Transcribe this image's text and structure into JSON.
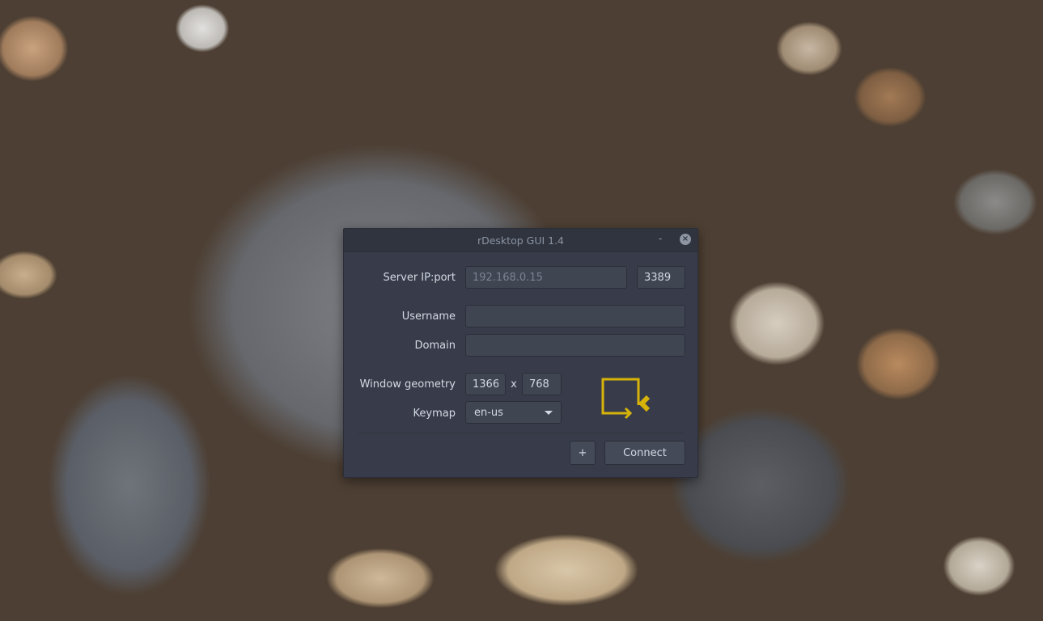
{
  "window": {
    "title": "rDesktop GUI 1.4",
    "minimize_glyph": "-",
    "close_glyph": "×"
  },
  "form": {
    "server_label": "Server IP:port",
    "server_ip_placeholder": "192.168.0.15",
    "server_port_value": "3389",
    "username_label": "Username",
    "username_value": "",
    "domain_label": "Domain",
    "domain_value": "",
    "geometry_label": "Window geometry",
    "geometry_width": "1366",
    "geometry_separator": "x",
    "geometry_height": "768",
    "keymap_label": "Keymap",
    "keymap_selected": "en-us"
  },
  "actions": {
    "add_label": "+",
    "connect_label": "Connect"
  },
  "icons": {
    "logo": "remote-desktop-logo-icon",
    "dropdown": "chevron-down-icon"
  },
  "colors": {
    "window_bg": "#383c4a",
    "titlebar_bg": "#2f343f",
    "logo_accent": "#d7b30a"
  }
}
